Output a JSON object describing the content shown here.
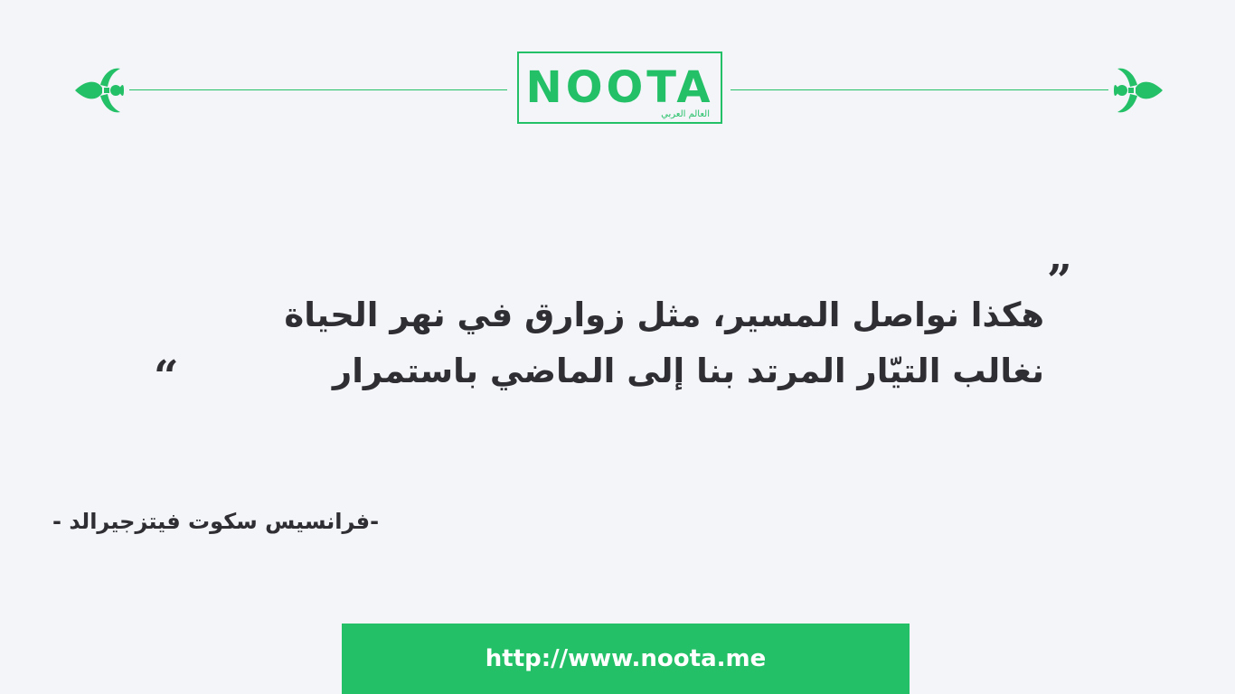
{
  "header": {
    "logo_text": "NOOTA",
    "logo_subtitle": "العالم العربي",
    "left_ornament_icon": "fleur-de-lis-icon",
    "right_ornament_icon": "fleur-de-lis-icon"
  },
  "quote": {
    "line1": "هكذا نواصل المسير، مثل زوارق في نهر الحياة",
    "line2": "نغالب التيّار المرتد بنا إلى الماضي باستمرار",
    "open_mark": "”",
    "close_mark": "“"
  },
  "author": {
    "name": "-فرانسيس سكوت فيتزجيرالد -"
  },
  "footer": {
    "url": "http://www.noota.me"
  },
  "colors": {
    "accent": "#24c067",
    "background": "#f4f5f9",
    "text": "#2e2e33"
  }
}
